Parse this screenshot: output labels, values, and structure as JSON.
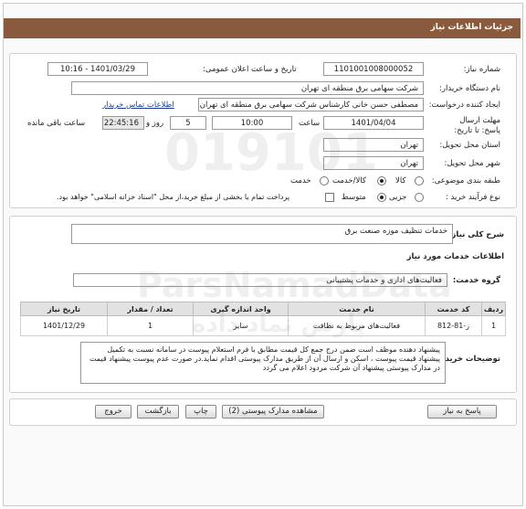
{
  "header": {
    "title": "جزئیات اطلاعات نیاز"
  },
  "fields": {
    "need_number_label": "شماره نیاز:",
    "need_number": "1101001008000052",
    "announce_label": "تاریخ و ساعت اعلان عمومی:",
    "announce_value": "1401/03/29 - 10:16",
    "buyer_label": "نام دستگاه خریدار:",
    "buyer_value": "شرکت سهامی برق منطقه ای تهران",
    "creator_label": "ایجاد کننده درخواست:",
    "creator_value": "مصطفی حسن خانی  کارشناس شرکت سهامی برق منطقه ای تهران",
    "contact_link": "اطلاعات تماس خریدار",
    "deadline_label": "مهلت ارسال پاسخ: تا تاریخ:",
    "deadline_date": "1401/04/04",
    "time_label": "ساعت",
    "deadline_time": "10:00",
    "days_value": "5",
    "days_label": "روز و",
    "remaining_time": "22:45:16",
    "remaining_label": "ساعت باقی مانده",
    "province_label": "استان محل تحویل:",
    "province_value": "تهران",
    "city_label": "شهر محل تحویل:",
    "city_value": "تهران",
    "category_label": "طبقه بندی موضوعی:",
    "category_options": [
      "کالا",
      "کالا/خدمت",
      "خدمت"
    ],
    "process_label": "نوع فرآیند خرید :",
    "process_options": [
      "جزیی",
      "متوسط"
    ],
    "payment_note": "پرداخت تمام یا بخشی از مبلغ خرید،از محل \"اسناد خزانه اسلامی\" خواهد بود."
  },
  "need": {
    "summary_label": "شرح کلی نیاز:",
    "summary_value": "خدمات تنظیف موزه صنعت برق",
    "services_title": "اطلاعات خدمات مورد نیاز",
    "group_label": "گروه خدمت:",
    "group_value": "فعالیت‌های اداری و خدمات پشتیبانی"
  },
  "table": {
    "headers": [
      "ردیف",
      "کد خدمت",
      "نام خدمت",
      "واحد اندازه گیری",
      "تعداد / مقدار",
      "تاریخ نیاز"
    ],
    "rows": [
      [
        "1",
        "ز-81-812",
        "فعالیت‌های مربوط به نظافت",
        "سایر",
        "1",
        "1401/12/29"
      ]
    ]
  },
  "notes": {
    "label": "توضیحات خریدار:",
    "text": "پیشنهاد دهنده موظف است ضمن درج جمع کل قیمت مطابق با فرم استعلام پیوست در سامانه نسبت به تکمیل پیشنهاد قیمت پیوست ، اسکن و ارسال آن از طریق مدارک پیوستی اقدام نماید.در صورت عدم پیوست پیشنهاد قیمت در مدارک پیوستی پیشنهاد آن شرکت مردود اعلام می گردد"
  },
  "buttons": {
    "reply": "پاسخ به نیاز",
    "attachments": "مشاهده مدارک پیوستی (2)",
    "print": "چاپ",
    "back": "بازگشت",
    "exit": "خروج"
  },
  "watermark": {
    "line1": "019101",
    "line2": "ParsNamadData",
    "line3": "پارس نماد داده"
  }
}
